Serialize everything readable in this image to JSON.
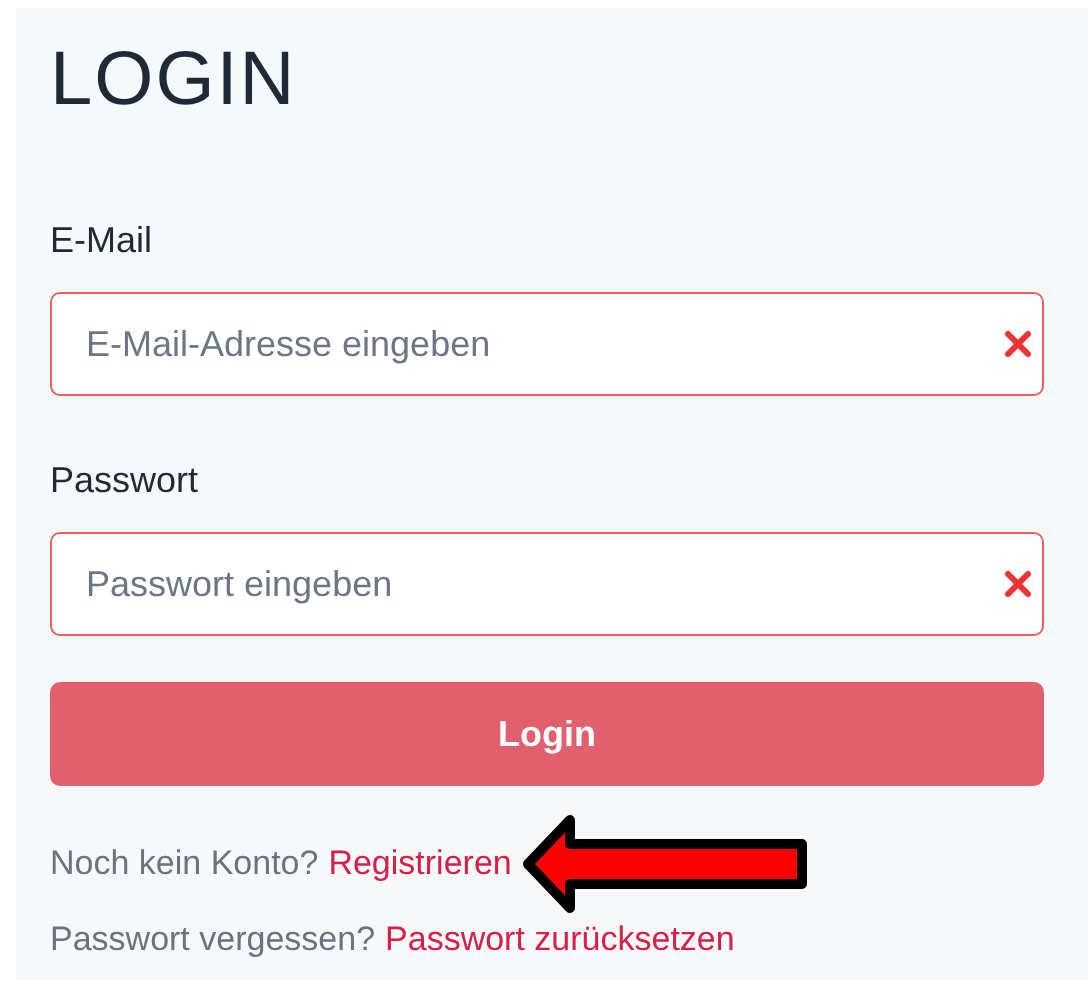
{
  "title": "LOGIN",
  "fields": [
    {
      "label": "E-Mail",
      "placeholder": "E-Mail-Adresse eingeben",
      "invalid": true
    },
    {
      "label": "Passwort",
      "placeholder": "Passwort eingeben",
      "invalid": true
    }
  ],
  "submit": {
    "label": "Login"
  },
  "links": [
    {
      "text": "Noch kein Konto?",
      "link": "Registrieren",
      "annotation": {
        "kind": "arrow"
      }
    },
    {
      "text": "Passwort vergessen?",
      "link": "Passwort zurücksetzen"
    }
  ]
}
